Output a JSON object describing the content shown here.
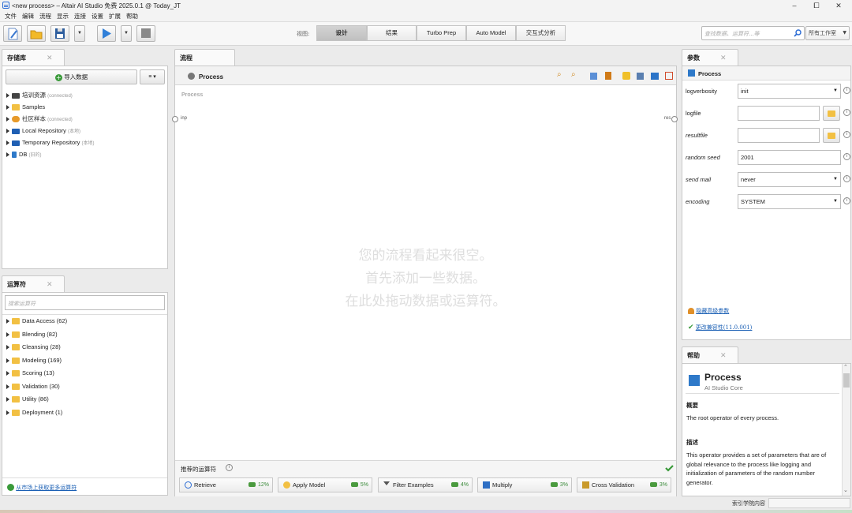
{
  "window": {
    "title": "<new process> – Altair AI Studio 免费 2025.0.1 @ Today_JT",
    "minimize": "–",
    "maximize": "⧠",
    "close": "✕"
  },
  "menu": [
    "文件",
    "编辑",
    "流程",
    "显示",
    "连接",
    "设置",
    "扩展",
    "帮助"
  ],
  "toolbar": {
    "views_label": "视图:",
    "views": [
      "设计",
      "结果",
      "Turbo Prep",
      "Auto Model",
      "交互式分析"
    ],
    "active_view": "设计",
    "search_placeholder": "查找数据、运算符...等",
    "search_scope": "所有工作室"
  },
  "repository": {
    "tab": "存储库",
    "import_button": "导入数据",
    "menu_button": "≡ ▾",
    "items": [
      {
        "label": "培训资源",
        "note": "(connected)",
        "icon": "graduation-cap-icon"
      },
      {
        "label": "Samples",
        "note": "",
        "icon": "folder-icon"
      },
      {
        "label": "社区样本",
        "note": "(connected)",
        "icon": "community-icon"
      },
      {
        "label": "Local Repository",
        "note": "(本地)",
        "icon": "monitor-icon"
      },
      {
        "label": "Temporary Repository",
        "note": "(本地)",
        "icon": "monitor-icon"
      },
      {
        "label": "DB",
        "note": "(旧的)",
        "icon": "database-icon"
      }
    ]
  },
  "operators": {
    "tab": "运算符",
    "search_placeholder": "搜索运算符",
    "items": [
      "Data Access (62)",
      "Blending (82)",
      "Cleansing (28)",
      "Modeling (169)",
      "Scoring (13)",
      "Validation (30)",
      "Utility (86)",
      "Deployment (1)"
    ],
    "marketplace_link": "从市场上获取更多运算符"
  },
  "process": {
    "tab": "流程",
    "breadcrumb": "Process",
    "canvas_title": "Process",
    "port_in": "inp",
    "port_out": "res",
    "empty_lines": [
      "您的流程看起来很空。",
      "首先添加一些数据。",
      "在此处拖动数据或运算符。"
    ],
    "recommended_label": "推荐的运算符",
    "recommended": [
      {
        "label": "Retrieve",
        "pct": "12%",
        "icon": "retrieve-icon"
      },
      {
        "label": "Apply Model",
        "pct": "5%",
        "icon": "lightbulb-icon"
      },
      {
        "label": "Filter Examples",
        "pct": "4%",
        "icon": "filter-icon"
      },
      {
        "label": "Multiply",
        "pct": "3%",
        "icon": "multiply-icon"
      },
      {
        "label": "Cross Validation",
        "pct": "3%",
        "icon": "cross-validation-icon"
      }
    ]
  },
  "parameters": {
    "tab": "参数",
    "header": "Process",
    "rows": [
      {
        "label": "logverbosity",
        "value": "init",
        "type": "select",
        "italic": false
      },
      {
        "label": "logfile",
        "value": "",
        "type": "file",
        "italic": false
      },
      {
        "label": "resultfile",
        "value": "",
        "type": "file",
        "italic": true
      },
      {
        "label": "random seed",
        "value": "2001",
        "type": "text",
        "italic": true
      },
      {
        "label": "send mail",
        "value": "never",
        "type": "select",
        "italic": true
      },
      {
        "label": "encoding",
        "value": "SYSTEM",
        "type": "select",
        "italic": true
      }
    ],
    "hide_advanced": "隐藏高级参数",
    "compatibility": "更改兼容性(11.0.001)"
  },
  "help": {
    "tab": "帮助",
    "title": "Process",
    "subtitle": "AI Studio Core",
    "overview_heading": "概要",
    "overview": "The root operator of every process.",
    "desc_heading": "描述",
    "desc": "This operator provides a set of parameters that are of global relevance to the process like logging and initialization of parameters of the random number generator.",
    "index_label": "索引学院内容"
  },
  "colors": {
    "accent": "#2a6bd4",
    "folder": "#f2c043",
    "success": "#3a8a3a"
  }
}
